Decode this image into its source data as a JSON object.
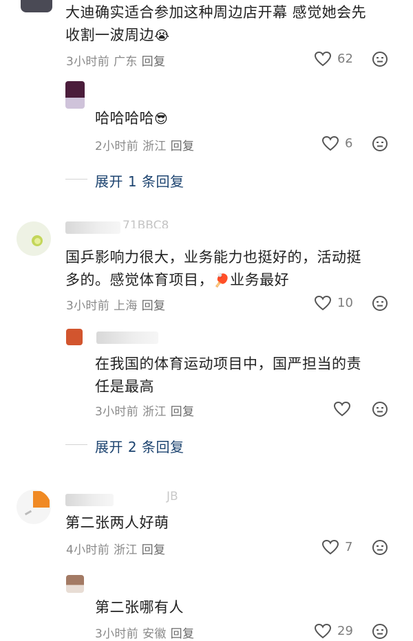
{
  "comments": [
    {
      "text_line1": "大迪确实适合参加这种周边店开幕 感觉她会先",
      "text_line2": "收割一波周边",
      "emoji": "😭",
      "time": "3小时前",
      "location": "广东",
      "reply": "回复",
      "likes": "62",
      "replies": [
        {
          "text": "哈哈哈哈",
          "emoji": "😎",
          "time": "2小时前",
          "location": "浙江",
          "reply": "回复",
          "likes": "6"
        }
      ],
      "expand_label": "展开 1 条回复"
    },
    {
      "username_fragment": "71BBC8",
      "text_line1": "国乒影响力很大，业务能力也挺好的，活动挺",
      "text_line2_a": "多的。感觉体育项目，",
      "emoji": "🏓",
      "text_line2_b": "业务最好",
      "time": "3小时前",
      "location": "上海",
      "reply": "回复",
      "likes": "10",
      "replies": [
        {
          "text_line1": "在我国的体育运动项目中，国严担当的责",
          "text_line2": "任是最高",
          "time": "3小时前",
          "location": "浙江",
          "reply": "回复",
          "likes": ""
        }
      ],
      "expand_label": "展开 2 条回复"
    },
    {
      "username_fragment": "JB",
      "text": "第二张两人好萌",
      "time": "4小时前",
      "location": "浙江",
      "reply": "回复",
      "likes": "7",
      "replies": [
        {
          "text": "第二张哪有人",
          "time": "3小时前",
          "location": "安徽",
          "reply": "回复",
          "likes": "29"
        }
      ]
    }
  ],
  "colors": {
    "expand_link": "#1d4470",
    "meta_gray": "#8a8a8a",
    "icon_gray": "#555555"
  }
}
